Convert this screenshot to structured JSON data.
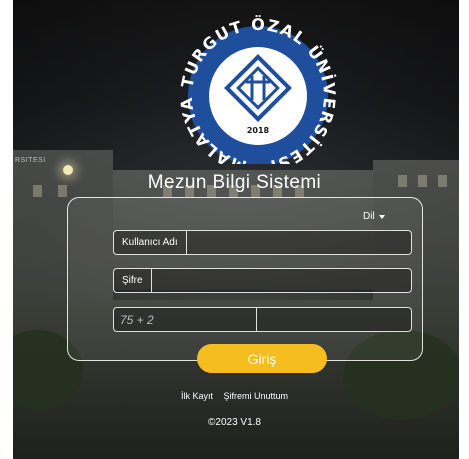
{
  "logo": {
    "ring_text": "MALATYA TURGUT ÖZAL ÜNİVERSİTESİ",
    "year": "2018",
    "ring_color": "#1f4f9c",
    "icon": "university-seal-icon"
  },
  "background": {
    "sign_text": "RSITESI"
  },
  "app": {
    "title": "Mezun Bilgi Sistemi"
  },
  "language": {
    "label": "Dil",
    "icon": "caret-down-icon"
  },
  "form": {
    "username_label": "Kullanıcı Adı",
    "username_value": "",
    "password_label": "Şifre",
    "password_value": "",
    "captcha_question": "75 + 2",
    "captcha_value": ""
  },
  "actions": {
    "login_label": "Giriş",
    "login_color": "#f5bd1f",
    "register_label": "İlk Kayıt",
    "forgot_label": "Şifremi Unuttum"
  },
  "footer": {
    "copyright": "©2023 V1.8"
  }
}
